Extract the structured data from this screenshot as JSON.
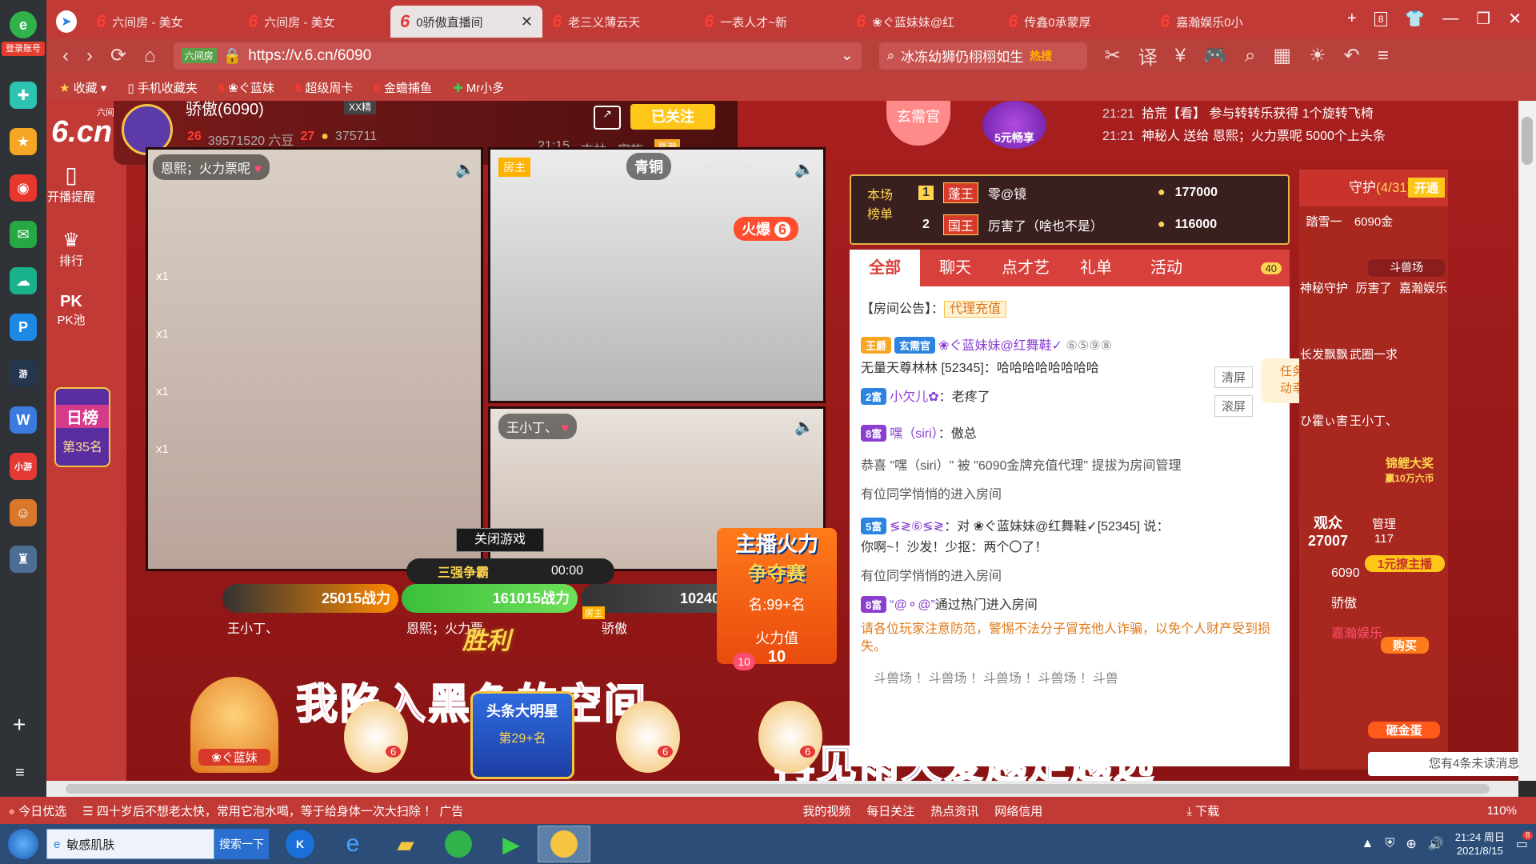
{
  "browser": {
    "tabs": [
      {
        "label": "六间房 - 美女",
        "active": false
      },
      {
        "label": "六间房 - 美女",
        "active": false
      },
      {
        "label": "0骄傲直播间",
        "active": true
      },
      {
        "label": "老三义薄云天",
        "active": false
      },
      {
        "label": "一表人才~新",
        "active": false
      },
      {
        "label": "❀ぐ蓝妹妹@红",
        "active": false
      },
      {
        "label": "传鑫0承蒙厚",
        "active": false
      },
      {
        "label": "嘉瀚娱乐0小",
        "active": false
      }
    ],
    "tab_count": "8",
    "url": "https://v.6.cn/6090",
    "site_badge": "六间房",
    "search_text": "冰冻幼狮仍栩栩如生",
    "search_hot": "热搜",
    "bookmarks": [
      "收藏",
      "手机收藏夹",
      "❀ぐ蓝妹",
      "超级周卡",
      "金蟾捕鱼",
      "Mr小多"
    ],
    "login_label": "登录账号"
  },
  "host": {
    "name": "骄傲(6090)",
    "level_tag": "XX精",
    "rank_num_left": "26",
    "beans": "39571520 六豆",
    "rank_num_right": "27",
    "coins": "375711",
    "followed_label": "已关注",
    "time_label": "21:15",
    "location": "吉林",
    "family": "家族",
    "family_tag": "嘉瀚",
    "site_logo": "6.cn",
    "site_logo_sub": "六间房"
  },
  "left_nav": {
    "items": [
      "开播提醒",
      "排行",
      "PK池"
    ],
    "daily_rank_title": "日榜",
    "daily_rank_value": "第35名"
  },
  "event_banner": {
    "label": "玄需官",
    "five_yuan": "5元畅享"
  },
  "top_messages": [
    {
      "time": "21:21",
      "text": "拾荒【看】 参与转转乐获得 1个旋转飞椅"
    },
    {
      "time": "21:21",
      "text": "神秘人 送给 恩熙；火力票呢 5000个上头条"
    }
  ],
  "video": {
    "left_user": "恩熙；火力票呢",
    "gift_counts": [
      "x1",
      "x1",
      "x1",
      "x1"
    ],
    "room_owner_label": "房主",
    "tier_label": "青铜",
    "fire_label": "火爆",
    "fire_count": "6",
    "bottom_user": "王小丁、",
    "close_game": "关闭游戏",
    "pk_title": "三强争霸",
    "pk_timer": "00:00",
    "pk_left_score": "25015战力",
    "pk_mid_score": "161015战力",
    "pk_right_score": "10240战力",
    "pk_left_name": "王小丁、",
    "pk_mid_name": "恩熙；火力票",
    "pk_right_name": "骄傲",
    "pk_right_tag": "房主",
    "win_label": "胜利",
    "contest_title_1": "主播火力",
    "contest_title_2": "争夺赛",
    "contest_rank": "名:99+名",
    "fire_value_label": "火力值",
    "fire_value": "10",
    "gift_ten": "10",
    "subtitle_top": "我陷入黑色的空间",
    "subtitle_bottom": "再见雨天爱越走越远",
    "headline_label": "头条大明星",
    "headline_rank": "第29+名",
    "seat_user": "❀ぐ蓝妹",
    "seat_badges": [
      "6",
      "6",
      "6"
    ]
  },
  "leaderboard": {
    "title_1": "本场",
    "title_2": "榜单",
    "rows": [
      {
        "rank": "1",
        "tag": "蓬王",
        "name": "零@镜",
        "score": "177000"
      },
      {
        "rank": "2",
        "tag": "国王",
        "name": "厉害了（啥也不是）",
        "score": "116000"
      }
    ]
  },
  "chat": {
    "tabs": [
      "全部",
      "聊天",
      "点才艺",
      "礼单",
      "活动"
    ],
    "car_badge": "40",
    "notice_label": "【房间公告】：",
    "notice_link": "代理充值",
    "messages": [
      {
        "badge": "王爵",
        "tag": "玄需官",
        "user": "❀ぐ蓝妹妹@红舞鞋✓",
        "extra": "⑥⑤⑨⑧"
      },
      {
        "text": "无量天尊林林 [52345]：哈哈哈哈哈哈哈哈"
      },
      {
        "badge": "2富",
        "user": "小欠儿✿",
        "text": "：老疼了"
      },
      {
        "badge": "8富",
        "user": "嘿（siri）",
        "text": "：傲总"
      },
      {
        "text": "恭喜 \"嘿（siri）\" 被 \"6090金牌充值代理\" 提拔为房间管理"
      },
      {
        "text": "有位同学悄悄的进入房间"
      },
      {
        "badge": "5富",
        "user": "≶≷⑥≶≷",
        "text": "：对 ❀ぐ蓝妹妹@红舞鞋✓[52345] 说："
      },
      {
        "text": "你啊~！沙发！少抠：两个〇了！"
      },
      {
        "text": "有位同学悄悄的进入房间"
      },
      {
        "badge": "8富",
        "user": "“@⚬@”",
        "text": "通过热门进入房间"
      }
    ],
    "clear_label": "清屏",
    "scroll_label": "滚屏",
    "warning": "请各位玩家注意防范，警惕不法分子冒充他人诈骗，以免个人财产受到损失。",
    "ticker": "斗兽场 ！斗兽场 ！斗兽场 ！斗兽场 ！斗兽",
    "task_popup": "任务完成，点击领取锦鲤活动幸运码~"
  },
  "guard": {
    "title": "守护",
    "count": "(4/31)",
    "open_label": "开通",
    "members": [
      "踏雪一",
      "6090金",
      "",
      "神秘守护",
      "厉害了",
      "嘉瀚娱乐",
      "长发飘飘",
      "武圈一求",
      "",
      "ひ霍ぃ害",
      "王小丁、",
      ""
    ],
    "audience_label": "观众",
    "audience_count": "27007",
    "admin_label": "管理",
    "admin_count": "117",
    "side_promos": [
      "斗兽场",
      "锦鲤大奖",
      "赢10万六币",
      "1元撩主播",
      "购买",
      "砸金蛋"
    ],
    "viewer_rows": [
      "6090",
      "骄傲",
      "嘉瀚娱乐"
    ],
    "unread_text": "您有4条未读消息"
  },
  "statusbar": {
    "daily": "今日优选",
    "news": "四十岁后不想老太快，常用它泡水喝，等于给身体一次大扫除 ！",
    "ad": "广告",
    "items": [
      "我的视频",
      "每日关注",
      "热点资讯",
      "网络信用",
      "下载"
    ],
    "zoom": "110%"
  },
  "taskbar": {
    "search_text": "敏感肌肤",
    "search_button": "搜索一下",
    "time": "21:24 周日",
    "date": "2021/8/15",
    "notify_count": "8"
  }
}
